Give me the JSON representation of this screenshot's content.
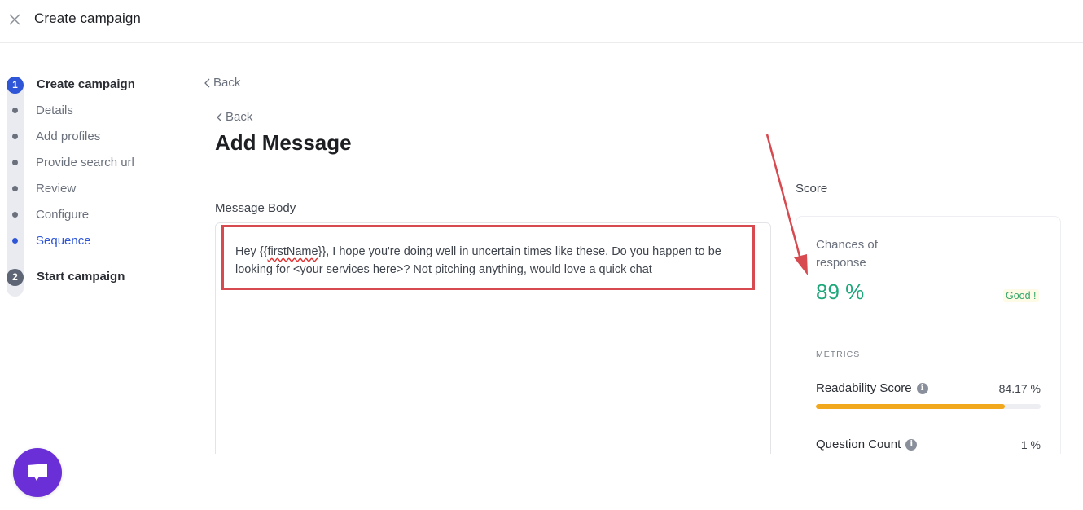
{
  "header": {
    "title": "Create campaign",
    "close_icon": "close-icon"
  },
  "stepper": {
    "steps": [
      {
        "number": "1",
        "title": "Create campaign",
        "state": "active",
        "substeps": [
          {
            "label": "Details",
            "current": false
          },
          {
            "label": "Add profiles",
            "current": false
          },
          {
            "label": "Provide search url",
            "current": false
          },
          {
            "label": "Review",
            "current": false
          },
          {
            "label": "Configure",
            "current": false
          },
          {
            "label": "Sequence",
            "current": true
          }
        ]
      },
      {
        "number": "2",
        "title": "Start campaign",
        "state": "inactive"
      }
    ]
  },
  "main": {
    "back_outer": "Back",
    "back_inner": "Back",
    "title": "Add Message",
    "message_body_label": "Message Body",
    "message": {
      "prefix": "Hey {{",
      "variable": "firstName",
      "suffix": "}}, I hope you're doing well in uncertain times like these. Do you happen to be looking for <your services here>? Not pitching anything, would love a quick chat"
    }
  },
  "score": {
    "label": "Score",
    "chances_label": "Chances of response",
    "chances_value": "89 %",
    "rating": "Good !",
    "metrics_heading": "METRICS",
    "metrics": [
      {
        "name": "Readability Score",
        "value": "84.17 %",
        "progress": 0.8417,
        "info_icon": "info-icon"
      },
      {
        "name": "Question Count",
        "value": "1 %",
        "info_icon": "info-icon"
      }
    ]
  },
  "colors": {
    "accent": "#2f56d6",
    "score_green": "#1fa77c",
    "progress_orange": "#f2a81d",
    "annotation_red": "#d64a50",
    "chat_purple": "#6a2fd6"
  },
  "chat_widget": {
    "icon": "chat-bubble-icon"
  }
}
